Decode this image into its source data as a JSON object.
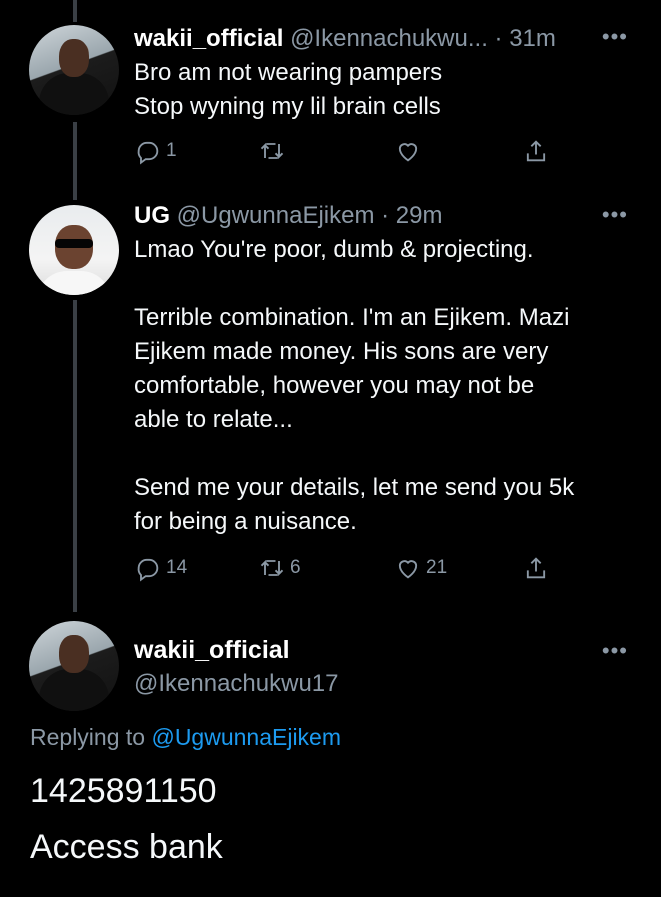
{
  "tweets": [
    {
      "name": "wakii_official",
      "meta": "@Ikennachukwu... · 31m",
      "lines": [
        "Bro am not wearing pampers",
        "Stop wyning my lil brain cells"
      ],
      "reply_count": "1",
      "retweet_count": "",
      "like_count": ""
    },
    {
      "name": "UG",
      "meta": "@UgwunnaEjikem · 29m",
      "lines": [
        "Lmao You're poor, dumb & projecting.",
        "",
        "Terrible combination. I'm an Ejikem. Mazi",
        "Ejikem made money. His sons are very",
        "comfortable, however you may not be",
        "able to relate...",
        "",
        "Send me your details, let me send you 5k",
        "for being a nuisance."
      ],
      "reply_count": "14",
      "retweet_count": "6",
      "like_count": "21"
    }
  ],
  "main_tweet": {
    "name": "wakii_official",
    "handle": "@Ikennachukwu17",
    "replying_prefix": "Replying to",
    "replying_to": "@UgwunnaEjikem",
    "line1": "1425891150",
    "line2": "Access bank"
  },
  "more_label": "•••",
  "icons": [
    "reply-icon",
    "retweet-icon",
    "like-icon",
    "share-icon",
    "more-icon"
  ]
}
